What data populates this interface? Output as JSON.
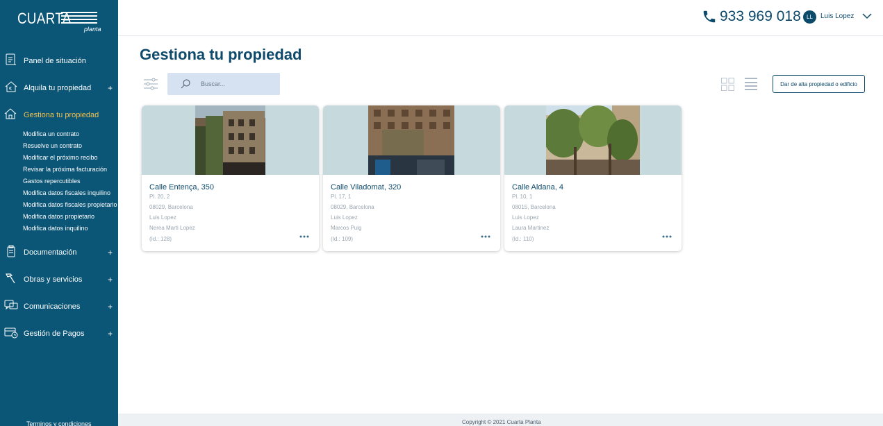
{
  "brand": {
    "name": "CUARTA",
    "sub": "planta"
  },
  "sidebar": {
    "items": [
      {
        "label": "Panel de situación",
        "plus": ""
      },
      {
        "label": "Alquila tu propiedad",
        "plus": "+"
      },
      {
        "label": "Gestiona tu propiedad",
        "plus": ""
      },
      {
        "label": "Documentación",
        "plus": "+"
      },
      {
        "label": "Obras y servicios",
        "plus": "+"
      },
      {
        "label": "Comunicaciones",
        "plus": "+"
      },
      {
        "label": "Gestión de Pagos",
        "plus": "+"
      }
    ],
    "submenu": [
      "Modifica un contrato",
      "Resuelve un contrato",
      "Modificar el próximo recibo",
      "Revisar la próxima facturación",
      "Gastos repercutibles",
      "Modifica datos fiscales inquilino",
      "Modifica datos fiscales propietario",
      "Modifica datos propietario",
      "Modifica datos inquilino"
    ],
    "footer": "Terminos y condiciones"
  },
  "header": {
    "phone": "933 969 018",
    "avatar_initials": "LL",
    "user_name": "Luis Lopez"
  },
  "main": {
    "title": "Gestiona tu propiedad",
    "search_placeholder": "Buscar...",
    "add_button": "Dar de alta propiedad o edificio"
  },
  "properties": [
    {
      "address": "Calle Entença, 350",
      "floor": "Pl. 20, 2",
      "city": "08029, Barcelona",
      "owner": "Luis Lopez",
      "tenant": "Nerea Marti Lopez",
      "id": "(Id.: 128)"
    },
    {
      "address": "Calle Viladomat, 320",
      "floor": "Pl. 17, 1",
      "city": "08029, Barcelona",
      "owner": "Luis Lopez",
      "tenant": "Marcos Puig",
      "id": "(Id.: 109)"
    },
    {
      "address": "Calle Aldana, 4",
      "floor": "Pl. 10, 1",
      "city": "08015, Barcelona",
      "owner": "Luis Lopez",
      "tenant": "Laura Martinez",
      "id": "(Id.: 110)"
    }
  ],
  "footer": {
    "copyright": "Copyright © 2021 Cuarta Planta"
  },
  "colors": {
    "sidebar": "#0b5576",
    "accent": "#f2c14e",
    "text": "#0d4a6b",
    "search_bg": "#d6e2f2"
  },
  "icons": [
    "panel-icon",
    "rent-house-icon",
    "manage-house-icon",
    "documents-icon",
    "tools-icon",
    "chat-icon",
    "payments-icon",
    "phone-icon",
    "chevron-down-icon",
    "filter-icon",
    "search-icon",
    "grid-view-icon",
    "list-view-icon",
    "more-dots-icon"
  ]
}
